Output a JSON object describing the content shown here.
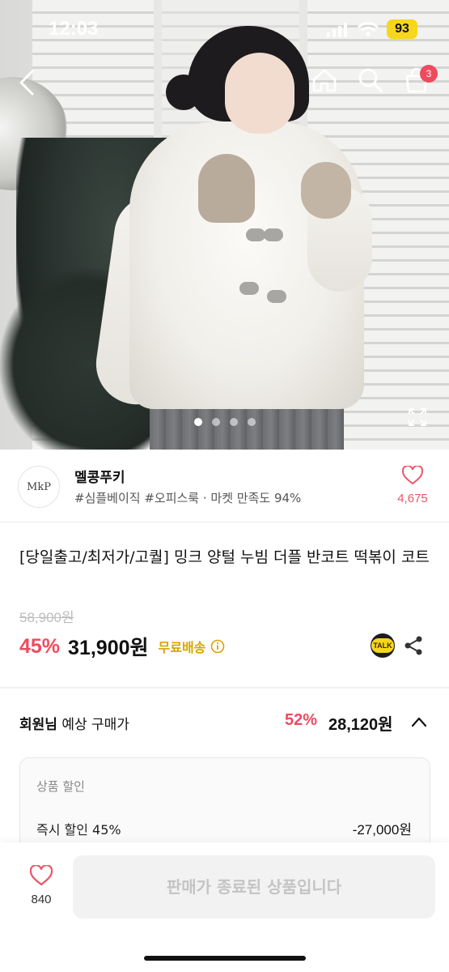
{
  "status_bar": {
    "time": "12:03",
    "battery": "93"
  },
  "header": {
    "cart_count": "3"
  },
  "gallery": {
    "total": 4,
    "active": 1
  },
  "shop": {
    "logo_text": "MkP",
    "name": "멜콩푸키",
    "tags": "#심플베이직 #오피스룩 · 마켓 만족도 94%",
    "like_count": "4,675"
  },
  "product": {
    "title": "[당일출고/최저가/고퀄] 밍크 양털 누빔 더플 반코트 떡볶이 코트",
    "original_price": "58,900원",
    "discount": "45%",
    "price": "31,900원",
    "free_shipping": "무료배송",
    "talk_label": "TALK"
  },
  "member_price": {
    "label_bold": "회원님",
    "label_rest": " 예상 구매가",
    "discount": "52%",
    "price": "28,120원"
  },
  "discount_detail": {
    "title": "상품 할인",
    "row_label": "즉시 할인 45%",
    "row_value": "-27,000원"
  },
  "bottom": {
    "wish_count": "840",
    "buy_button": "판매가 종료된 상품입니다"
  },
  "colors": {
    "accent_red": "#ef4b5e",
    "shipping_yellow": "#d9a400",
    "kakao_yellow": "#f7d71c"
  }
}
